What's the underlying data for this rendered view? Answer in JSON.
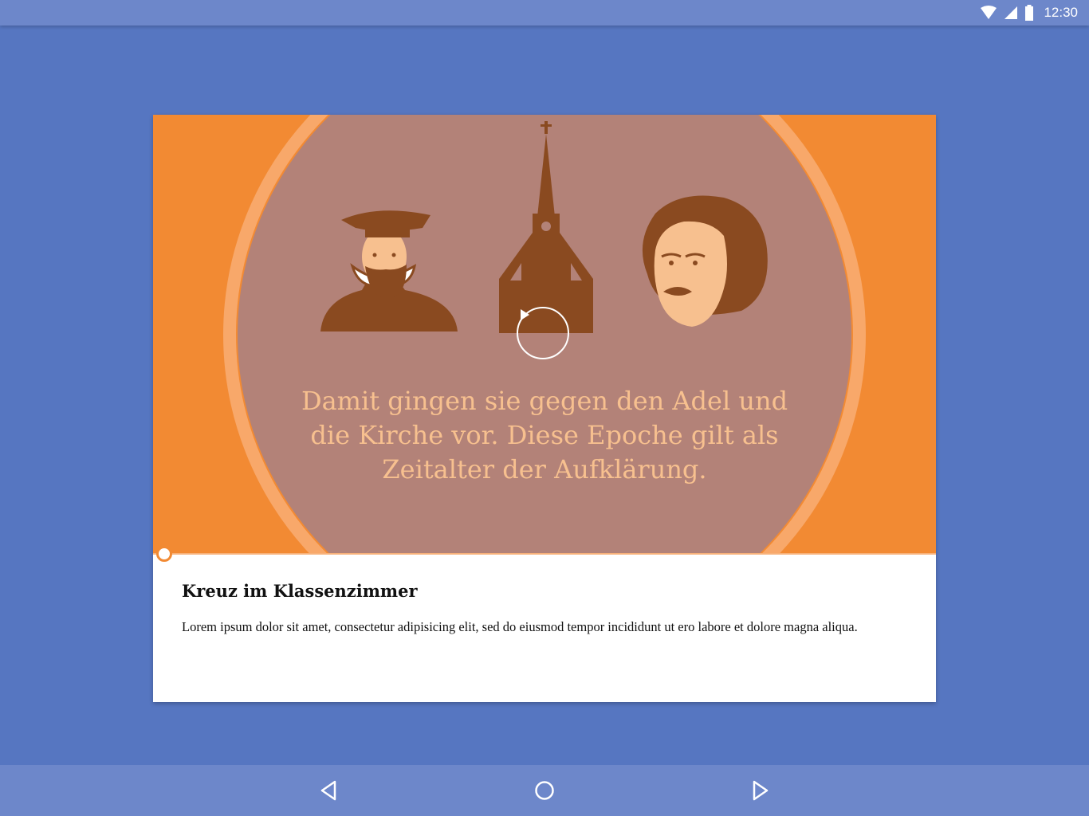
{
  "status_bar": {
    "time": "12:30",
    "icons": [
      "wifi-icon",
      "cell-signal-icon",
      "battery-icon"
    ]
  },
  "video": {
    "caption": "Damit gingen sie gegen den Adel und\ndie Kirche vor. Diese Epoche gilt als\nZeitalter der Aufklärung.",
    "progress": 0.0,
    "colors": {
      "background": "#f28a33",
      "circle": "#b38278",
      "ring": "#f8a86a",
      "figures": "#8a4a20",
      "skin": "#f7c08f"
    }
  },
  "card": {
    "title": "Kreuz im Klassenzimmer",
    "body": "Lorem ipsum dolor sit amet, consectetur adipisicing elit, sed do eiusmod tempor incididunt ut ero labore et dolore magna aliqua."
  },
  "nav_bar": {
    "buttons": [
      "back-icon",
      "home-icon",
      "forward-icon"
    ]
  }
}
